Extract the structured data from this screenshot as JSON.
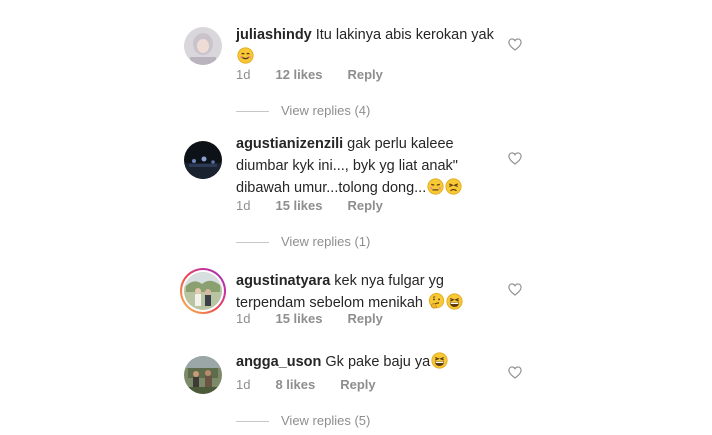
{
  "comments": [
    {
      "username": "juliashindy",
      "text": "Itu lakinya abis kerokan yak",
      "emojis": [
        "smiling-face-icon"
      ],
      "age": "1d",
      "likes": "12 likes",
      "reply_label": "Reply",
      "view_replies": "View replies (4)"
    },
    {
      "username": "agustianizenzili",
      "text": "gak perlu kaleee diumbar kyk ini..., byk yg liat anak\" dibawah umur...tolong dong...",
      "emojis": [
        "unamused-face-icon",
        "persevering-face-icon"
      ],
      "age": "1d",
      "likes": "15 likes",
      "reply_label": "Reply",
      "view_replies": "View replies (1)"
    },
    {
      "username": "agustinatyara",
      "text": "kek nya fulgar yg terpendam sebelom menikah",
      "emojis": [
        "thinking-face-icon",
        "grinning-squinting-face-icon"
      ],
      "age": "1d",
      "likes": "15 likes",
      "reply_label": "Reply",
      "view_replies": ""
    },
    {
      "username": "angga_uson",
      "text": "Gk pake baju ya",
      "emojis": [
        "grinning-squinting-face-icon"
      ],
      "age": "1d",
      "likes": "8 likes",
      "reply_label": "Reply",
      "view_replies": "View replies (5)"
    }
  ],
  "colors": {
    "text": "#262626",
    "secondary": "#8e8e8e",
    "divider": "#c7c7c7",
    "story_ring_start": "#f9c94f",
    "story_ring_end": "#8a3ab9",
    "emoji_yellow": "#f7c934"
  }
}
